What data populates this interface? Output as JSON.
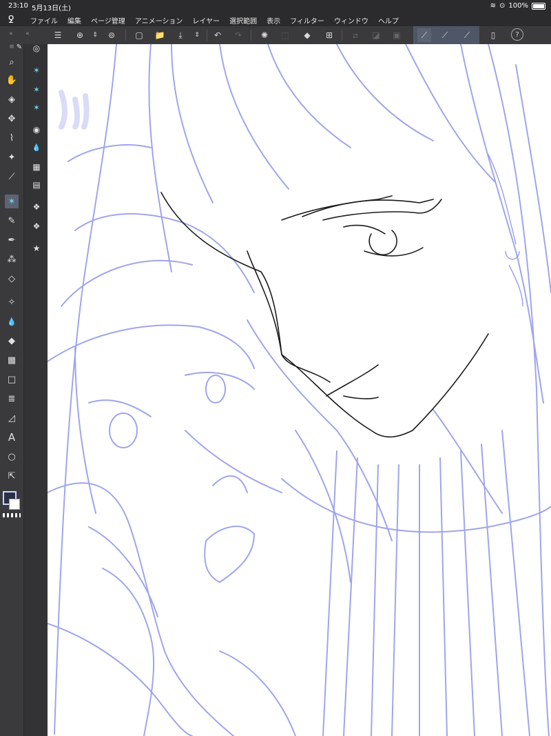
{
  "status": {
    "time": "23:10",
    "date": "5月13日(土)",
    "battery": "100%"
  },
  "menu": {
    "items": [
      "ファイル",
      "編集",
      "ページ管理",
      "アニメーション",
      "レイヤー",
      "選択範囲",
      "表示",
      "フィルター",
      "ウィンドウ",
      "ヘルプ"
    ]
  },
  "panel": {
    "collapse_left": "«",
    "collapse_right": "«"
  },
  "toolbar": {
    "menu_icon": "☰",
    "new_icon": "⊕",
    "open_icon": "📁",
    "save_icon": "⤓",
    "undo_icon": "↶",
    "redo_icon": "↷",
    "loading_icon": "✺",
    "transform_icon": "⬚",
    "fill_icon": "◆",
    "crop_icon": "⊞",
    "stroke1_icon": "⟋",
    "stroke2_icon": "⟋",
    "stroke3_icon": "⟋",
    "device_icon": "▯",
    "help_icon": "?"
  },
  "tools": {
    "zoom": "⌕",
    "hand": "✋",
    "select": "◈",
    "move": "✥",
    "lasso": "⌇",
    "wand": "✦",
    "eyedrop": "⟋",
    "pen": "✎",
    "brush": "✒",
    "spray": "⁂",
    "eraser": "◇",
    "blend": "✧",
    "water": "💧",
    "fill": "◆",
    "gradient": "▦",
    "rect": "□",
    "layers": "≣",
    "ruler": "◿",
    "text": "A",
    "balloon": "○",
    "operation": "⇱"
  },
  "subtools": {
    "navigator": "◎",
    "sub1": "✶",
    "sub2": "✶",
    "sub3": "✶",
    "circle": "◉",
    "drops": "💧",
    "grid": "▦",
    "film": "▤",
    "layer1": "❖",
    "layer2": "❖",
    "star": "★"
  },
  "colors": {
    "canvas_bg": "#ffffff",
    "sketch": "#7f86e6",
    "ink": "#1a1a1a"
  }
}
